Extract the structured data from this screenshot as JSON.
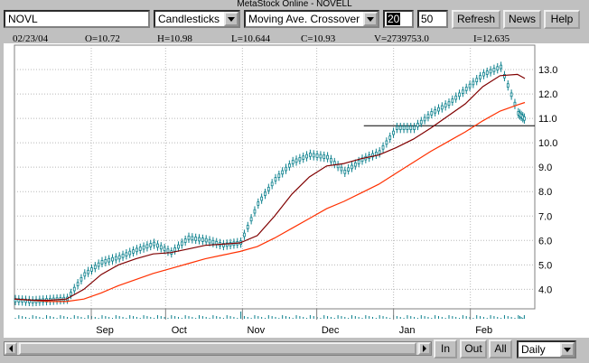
{
  "window": {
    "title": "MetaStock Online - NOVELL"
  },
  "toolbar": {
    "symbol": "NOVL",
    "chart_style": "Candlesticks",
    "indicator": "Moving Ave. Crossover",
    "period_fast": "20",
    "period_slow": "50",
    "refresh_label": "Refresh",
    "news_label": "News",
    "help_label": "Help"
  },
  "quote": {
    "date": "02/23/04",
    "open": "O=10.72",
    "high": "H=10.98",
    "low": "L=10.644",
    "close": "C=10.93",
    "volume": "V=2739753.0",
    "indicator_value": "I=12.635"
  },
  "bottom": {
    "in_label": "In",
    "out_label": "Out",
    "all_label": "All",
    "period": "Daily"
  },
  "colors": {
    "candles": "#0a7f8c",
    "ma_fast": "#800000",
    "ma_slow": "#ff3000",
    "grid": "#b8b8b8"
  },
  "chart_data": {
    "type": "line",
    "x": [
      "2003-08-01",
      "2003-08-08",
      "2003-08-15",
      "2003-08-22",
      "2003-08-29",
      "2003-09-05",
      "2003-09-12",
      "2003-09-19",
      "2003-09-26",
      "2003-10-03",
      "2003-10-10",
      "2003-10-17",
      "2003-10-24",
      "2003-10-31",
      "2003-11-07",
      "2003-11-14",
      "2003-11-21",
      "2003-11-28",
      "2003-12-05",
      "2003-12-12",
      "2003-12-19",
      "2003-12-26",
      "2004-01-02",
      "2004-01-09",
      "2004-01-16",
      "2004-01-23",
      "2004-01-30",
      "2004-02-06",
      "2004-02-13",
      "2004-02-20",
      "2004-02-23"
    ],
    "series": [
      {
        "values": [
          3.55,
          3.5,
          3.55,
          3.6,
          4.6,
          5.1,
          5.3,
          5.6,
          5.85,
          5.5,
          6.1,
          6.0,
          5.8,
          5.9,
          7.5,
          8.5,
          9.2,
          9.5,
          9.4,
          8.8,
          9.3,
          9.6,
          10.6,
          10.6,
          11.2,
          11.6,
          12.2,
          12.8,
          13.1,
          11.2,
          10.93
        ]
      },
      {
        "values": [
          3.6,
          3.55,
          3.55,
          3.6,
          4.0,
          4.6,
          5.0,
          5.25,
          5.45,
          5.5,
          5.65,
          5.8,
          5.85,
          5.9,
          6.2,
          7.0,
          7.9,
          8.6,
          9.05,
          9.15,
          9.35,
          9.5,
          9.8,
          10.15,
          10.6,
          11.1,
          11.6,
          12.3,
          12.75,
          12.8,
          12.635
        ]
      },
      {
        "values": [
          3.6,
          3.55,
          3.5,
          3.5,
          3.6,
          3.85,
          4.15,
          4.4,
          4.65,
          4.85,
          5.05,
          5.25,
          5.4,
          5.55,
          5.75,
          6.1,
          6.5,
          6.9,
          7.3,
          7.6,
          7.95,
          8.3,
          8.75,
          9.2,
          9.65,
          10.05,
          10.45,
          10.9,
          11.3,
          11.55,
          11.65
        ]
      }
    ],
    "categories": [
      "Sep",
      "Oct",
      "Nov",
      "Dec",
      "Jan",
      "Feb"
    ],
    "y_ticks": [
      "4.0",
      "5.0",
      "6.0",
      "7.0",
      "8.0",
      "9.0",
      "10.0",
      "11.0",
      "12.0",
      "13.0"
    ],
    "ylim": [
      3.2,
      14.0
    ],
    "reference_line": 10.7,
    "grid": true
  }
}
